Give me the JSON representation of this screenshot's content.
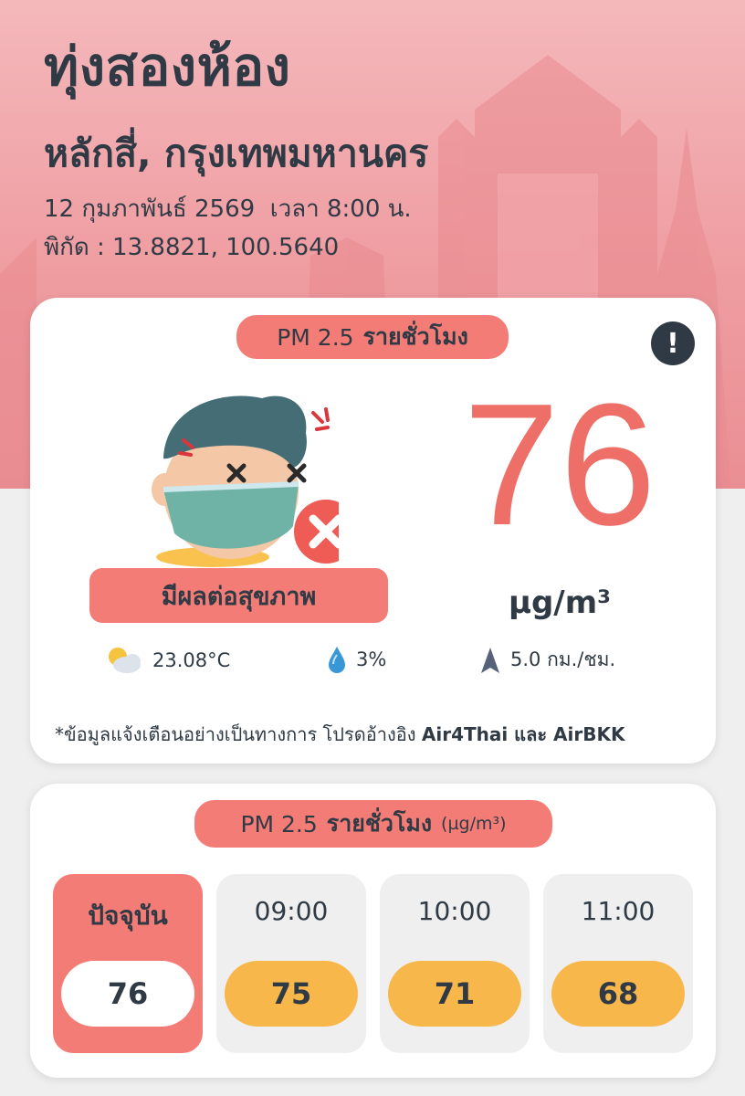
{
  "location": {
    "name": "ทุ่งสองห้อง",
    "district": "หลักสี่, กรุงเทพมหานคร",
    "datetime": "12 กุมภาพันธ์ 2569  เวลา 8:00 น.",
    "coordinates": "พิกัด : 13.8821, 100.5640"
  },
  "current": {
    "header_prefix": "PM 2.5",
    "header_bold": "รายชั่วโมง",
    "info_icon": "!",
    "status_label": "มีผลต่อสุขภาพ",
    "value": "76",
    "unit": "µg/m³",
    "temperature": "23.08°C",
    "humidity": "3%",
    "wind": "5.0 กม./ชม.",
    "note_prefix": "*ข้อมูลแจ้งเตือนอย่างเป็นทางการ โปรดอ้างอิง",
    "note_sources": "Air4Thai และ AirBKK",
    "colors": {
      "accent": "#f47c76",
      "value": "#ee6f68",
      "forecast": "#f8b74a",
      "text": "#2f3a45"
    }
  },
  "hourly": {
    "header_prefix": "PM 2.5",
    "header_bold": "รายชั่วโมง",
    "header_unit": "(µg/m³)",
    "slots": [
      {
        "time": "ปัจจุบัน",
        "value": "76"
      },
      {
        "time": "09:00",
        "value": "75"
      },
      {
        "time": "10:00",
        "value": "71"
      },
      {
        "time": "11:00",
        "value": "68"
      }
    ]
  }
}
